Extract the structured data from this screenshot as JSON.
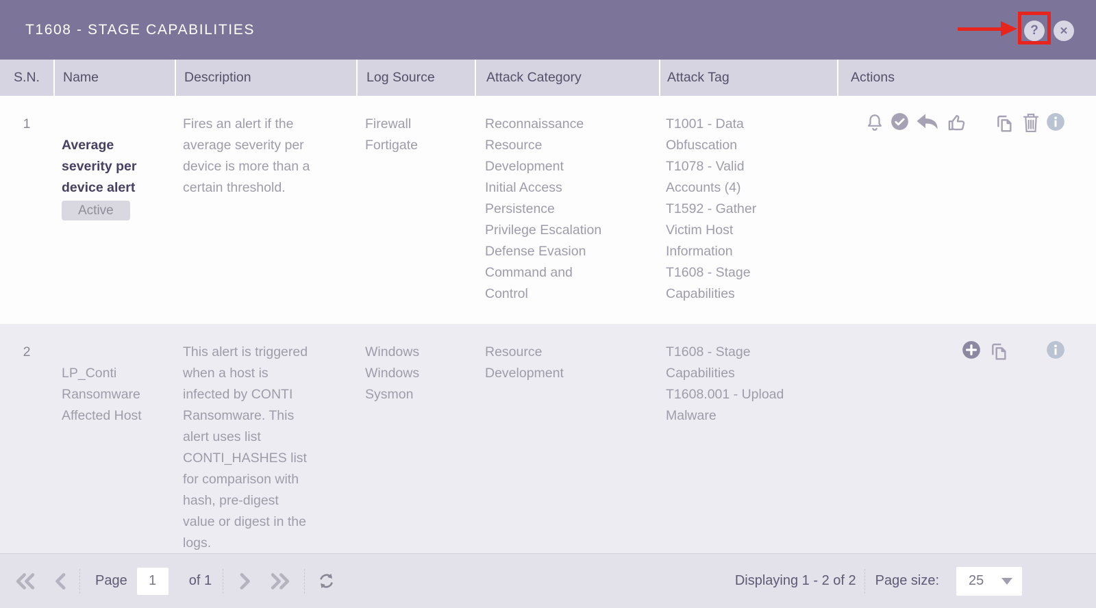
{
  "titlebar": {
    "title": "T1608 - STAGE CAPABILITIES",
    "help_glyph": "?",
    "close_glyph": "✕"
  },
  "annotation": {
    "highlight_color": "#e8251d",
    "highlighted_control": "help-button"
  },
  "colors": {
    "header_bg": "#7c7599",
    "table_head_bg": "#d6d4e0",
    "row_alt_bg": "#edecf2",
    "footer_bg": "#e3e1e9",
    "icon_gray": "#a6a1b3",
    "info_icon": "#b9c3d2"
  },
  "table": {
    "columns": [
      "S.N.",
      "Name",
      "Description",
      "Log Source",
      "Attack Category",
      "Attack Tag",
      "Actions"
    ],
    "rows": [
      {
        "sn": "1",
        "name": "Average\nseverity per\ndevice alert",
        "status_badge": "Active",
        "description": "Fires an alert if the\naverage severity per\ndevice is more than a\ncertain threshold.",
        "log_source": [
          "Firewall\nFortigate"
        ],
        "attack_category": [
          "Reconnaissance",
          "Resource\nDevelopment",
          "Initial Access",
          "Persistence",
          "Privilege Escalation",
          "Defense Evasion",
          "Command and\nControl"
        ],
        "attack_tag": [
          "T1001 - Data\nObfuscation",
          "T1078 - Valid\nAccounts (4)",
          "T1592 - Gather\nVictim Host\nInformation",
          "T1608 - Stage\nCapabilities"
        ],
        "action_icons": [
          "bell-icon",
          "check-circle-icon",
          "undo-icon",
          "thumbs-up-icon",
          "copy-icon",
          "trash-icon",
          "info-icon"
        ]
      },
      {
        "sn": "2",
        "name": "LP_Conti\nRansomware\nAffected Host",
        "description": "This alert is triggered\nwhen a host is\ninfected by CONTI\nRansomware. This\nalert uses list\nCONTI_HASHES list\nfor comparison with\nhash, pre-digest\nvalue or digest in the\nlogs.",
        "log_source": [
          "Windows",
          "Windows\nSysmon"
        ],
        "attack_category": [
          "Resource\nDevelopment"
        ],
        "attack_tag": [
          "T1608 - Stage\nCapabilities",
          "T1608.001 - Upload\nMalware"
        ],
        "action_icons": [
          "plus-circle-icon",
          "copy-icon",
          "info-icon"
        ]
      }
    ]
  },
  "footer": {
    "page_label": "Page",
    "page_value": "1",
    "of_label": "of 1",
    "displaying_text": "Displaying 1 - 2 of 2",
    "page_size_label": "Page size:",
    "page_size_value": "25"
  }
}
